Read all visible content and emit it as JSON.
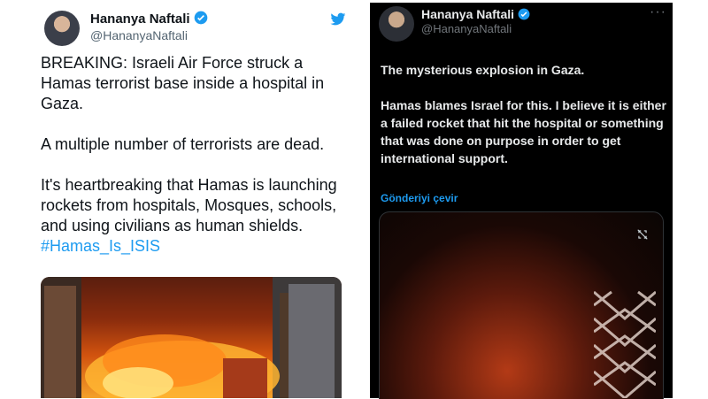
{
  "left_tweet": {
    "author_name": "Hananya Naftali",
    "handle": "@HananyaNaftali",
    "paragraphs": [
      "BREAKING: Israeli Air Force struck a Hamas terrorist base inside a hospital in Gaza.",
      "A multiple number of terrorists are dead."
    ],
    "last_paragraph_text": "It's heartbreaking that Hamas is launching rockets from hospitals, Mosques, schools, and using civilians as human shields. ",
    "hashtag": "#Hamas_Is_ISIS",
    "verified_color": "#1d9bf0",
    "logo_icon": "twitter-bird-icon"
  },
  "right_tweet": {
    "author_name": "Hananya Naftali",
    "handle": "@HananyaNaftali",
    "more_label": "···",
    "paragraphs": [
      "The mysterious explosion in Gaza.",
      "Hamas blames Israel for this. I believe it is either a failed rocket that hit the hospital or something that was done on purpose in order to get international support."
    ],
    "translate_label": "Gönderiyi çevir",
    "media_icon": "sensitive-media-icon",
    "theme": "dark"
  }
}
